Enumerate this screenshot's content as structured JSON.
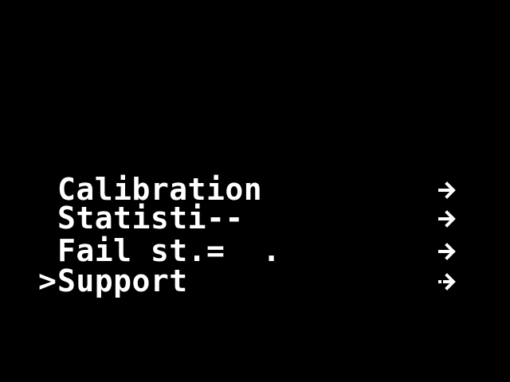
{
  "menu": {
    "cursor_glyph": ">",
    "selected_index": 3,
    "items": [
      {
        "label": "Calibration",
        "arrow_icon": "right-arrow-icon"
      },
      {
        "label": "Statisti--",
        "arrow_icon": "right-arrow-icon"
      },
      {
        "label": "Fail st.=  .",
        "arrow_icon": "right-arrow-icon"
      },
      {
        "label": "Support",
        "arrow_icon": "right-arrow-icon"
      }
    ]
  },
  "colors": {
    "background": "#000000",
    "foreground": "#ffffff"
  }
}
